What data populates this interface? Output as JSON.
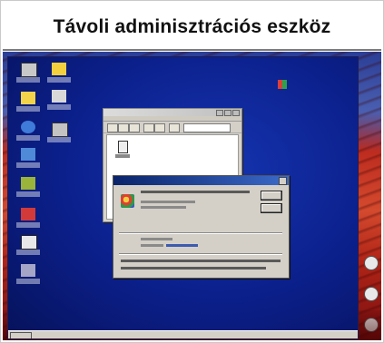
{
  "title": "Távoli adminisztrációs eszköz",
  "colors": {
    "remote_desktop": "#0b1f8a",
    "host_wallpaper": "#b8251c",
    "window_face": "#d4d0c8",
    "dialog_titlebar": "#0a246a"
  },
  "remote_desktop": {
    "desktop_icons": [
      "my-computer-icon",
      "folder-icon",
      "my-documents-icon",
      "network-icon",
      "internet-explorer-icon",
      "recycle-bin-icon",
      "network-places-icon",
      "connect-icon",
      "tools-icon",
      "application-icon",
      "shortcut-icon"
    ]
  },
  "explorer_window": {
    "file_icon": "file-icon"
  },
  "about_dialog": {
    "logo_icon": "application-logo-icon"
  },
  "host_desktop": {
    "side_icons": [
      "drive-icon",
      "drive-icon",
      "drive-icon"
    ],
    "bottom_icons": [
      "acrobat-icon",
      "document-icon",
      "network-icon"
    ]
  }
}
